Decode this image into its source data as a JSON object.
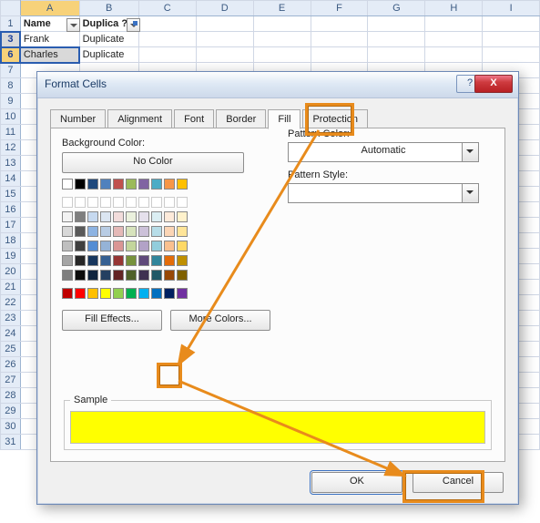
{
  "columns": [
    "A",
    "B",
    "C",
    "D",
    "E",
    "F",
    "G",
    "H",
    "I"
  ],
  "rows": {
    "header": {
      "num": "1",
      "a": "Name",
      "b": "Duplica    ?"
    },
    "r3": {
      "num": "3",
      "a": "Frank",
      "b": "Duplicate"
    },
    "r6": {
      "num": "6",
      "a": "Charles",
      "b": "Duplicate"
    },
    "blank": [
      "7",
      "8",
      "9",
      "10",
      "11",
      "12",
      "13",
      "14",
      "15",
      "16",
      "17",
      "18",
      "19",
      "20",
      "21",
      "22",
      "23",
      "24",
      "25",
      "26",
      "27",
      "28",
      "29",
      "30",
      "31"
    ]
  },
  "dialog": {
    "title": "Format Cells",
    "help": "?",
    "close": "X",
    "tabs": [
      "Number",
      "Alignment",
      "Font",
      "Border",
      "Fill",
      "Protection"
    ],
    "bg_label": "Background Color:",
    "nocolor": "No Color",
    "fill_effects": "Fill Effects...",
    "more_colors": "More Colors...",
    "pat_color": "Pattern Color:",
    "pat_auto": "Automatic",
    "pat_style": "Pattern Style:",
    "sample": "Sample",
    "ok": "OK",
    "cancel": "Cancel"
  },
  "palette": {
    "row1": [
      "#ffffff",
      "#000000",
      "#1f497d",
      "#4f81bd",
      "#c0504d",
      "#9bbb59",
      "#8064a2",
      "#4bacc6",
      "#f79646",
      "#ffc000"
    ],
    "theme": [
      [
        "#f2f2f2",
        "#7f7f7f",
        "#c6d9f0",
        "#dbe5f1",
        "#f2dcdb",
        "#ebf1dd",
        "#e5e0ec",
        "#dbeef3",
        "#fdeada",
        "#fff2cc"
      ],
      [
        "#d8d8d8",
        "#595959",
        "#8db3e2",
        "#b8cce4",
        "#e5b9b7",
        "#d7e3bc",
        "#ccc1d9",
        "#b7dde8",
        "#fbd5b5",
        "#ffe599"
      ],
      [
        "#bfbfbf",
        "#3f3f3f",
        "#548dd4",
        "#95b3d7",
        "#da9694",
        "#c3d69b",
        "#b2a2c7",
        "#92cddc",
        "#fac08f",
        "#ffd966"
      ],
      [
        "#a5a5a5",
        "#262626",
        "#17365d",
        "#366092",
        "#963634",
        "#76923c",
        "#5f497a",
        "#31859b",
        "#e36c09",
        "#bf8f00"
      ],
      [
        "#7f7f7f",
        "#0c0c0c",
        "#0f243e",
        "#244061",
        "#632423",
        "#4f6128",
        "#3f3151",
        "#205867",
        "#974806",
        "#7f6000"
      ]
    ],
    "standard": [
      "#c00000",
      "#ff0000",
      "#ffc000",
      "#ffff00",
      "#92d050",
      "#00b050",
      "#00b0f0",
      "#0070c0",
      "#002060",
      "#7030a0"
    ]
  }
}
